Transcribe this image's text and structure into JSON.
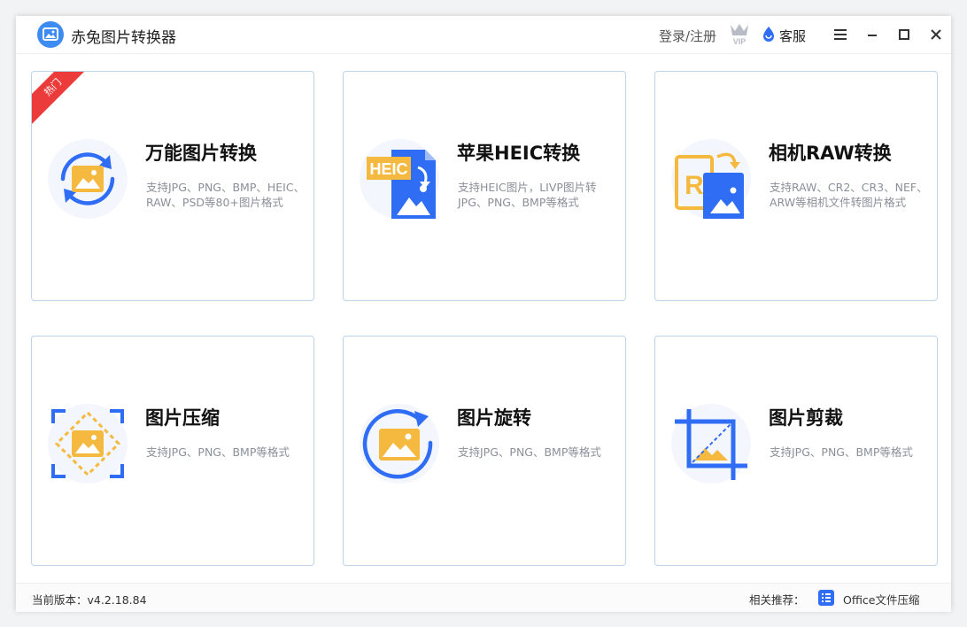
{
  "app": {
    "title": "赤兔图片转换器",
    "logo_icon": "image-icon",
    "accent_color": "#3e8bf2"
  },
  "header": {
    "login_label": "登录/注册",
    "vip_icon": "vip-crown-icon",
    "service_label": "客服",
    "service_icon": "service-drop-icon",
    "menu_icon": "hamburger-icon",
    "minimize_icon": "minimize-icon",
    "maximize_icon": "maximize-icon",
    "close_icon": "close-icon"
  },
  "cards": [
    {
      "title": "万能图片转换",
      "desc": "支持JPG、PNG、BMP、HEIC、RAW、PSD等80+图片格式",
      "badge": "热门",
      "icon": "universal-convert-icon"
    },
    {
      "title": "苹果HEIC转换",
      "desc": "支持HEIC图片，LIVP图片转JPG、PNG、BMP等格式",
      "icon": "heic-convert-icon",
      "icon_text": "HEIC"
    },
    {
      "title": "相机RAW转换",
      "desc": "支持RAW、CR2、CR3、NEF、ARW等相机文件转图片格式",
      "icon": "raw-convert-icon",
      "icon_text": "R"
    },
    {
      "title": "图片压缩",
      "desc": "支持JPG、PNG、BMP等格式",
      "icon": "image-compress-icon"
    },
    {
      "title": "图片旋转",
      "desc": "支持JPG、PNG、BMP等格式",
      "icon": "image-rotate-icon"
    },
    {
      "title": "图片剪裁",
      "desc": "支持JPG、PNG、BMP等格式",
      "icon": "image-crop-icon"
    }
  ],
  "footer": {
    "version_text": "当前版本：v4.2.18.84",
    "recommend_label": "相关推荐：",
    "recommend_app": "Office文件压缩",
    "recommend_icon": "office-compress-icon"
  },
  "colors": {
    "blue": "#2f6df5",
    "yellow": "#f5b940",
    "hot_red": "#ec3b3b",
    "card_border": "#bcd3e8"
  }
}
